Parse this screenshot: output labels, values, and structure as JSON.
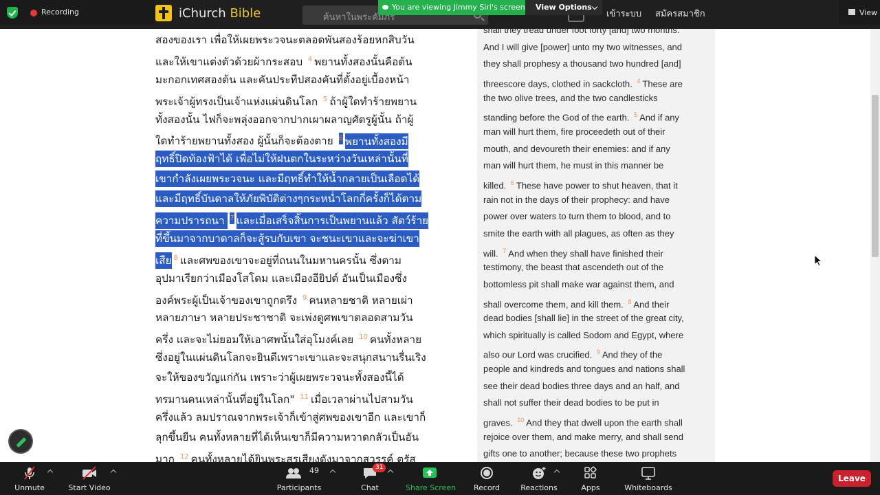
{
  "zoom": {
    "recording_label": "Recording",
    "viewing_banner": "You are viewing Jimmy Siri's screen",
    "view_options_label": "View Options",
    "view_right_label": "View",
    "toolbar": {
      "unmute": "Unmute",
      "start_video": "Start Video",
      "participants": "Participants",
      "participants_count": "49",
      "chat": "Chat",
      "chat_badge": "31",
      "share_screen": "Share Screen",
      "record": "Record",
      "reactions": "Reactions",
      "apps": "Apps",
      "whiteboards": "Whiteboards",
      "leave": "Leave"
    }
  },
  "site": {
    "logo_prefix": "iChurch",
    "logo_suffix": "Bible",
    "search_placeholder": "ค้นหาในพระคัมภีร์",
    "login": "เข้าระบบ",
    "register": "สมัครสมาชิก"
  },
  "thai_lines": [
    [
      {
        "t": "สองของเรา เพื่อให้เผยพระวจนะตลอดพันสองร้อยหกสิบวัน"
      }
    ],
    [
      {
        "t": "และให้เขาแต่งตัวด้วยผ้ากระสอบ "
      },
      {
        "v": "4"
      },
      {
        "t": "พยานทั้งสองนั้นคือต้น"
      }
    ],
    [
      {
        "t": "มะกอกเทศสองต้น และคันประทีปสองคันที่ตั้งอยู่เบื้องหน้า"
      }
    ],
    [
      {
        "t": "พระเจ้าผู้ทรงเป็นเจ้าแห่งแผ่นดินโลก "
      },
      {
        "v": "5"
      },
      {
        "t": "ถ้าผู้ใดทำร้ายพยาน"
      }
    ],
    [
      {
        "t": "ทั้งสองนั้น ไฟก็จะพลุ่งออกจากปากเผาผลาญศัตรูผู้นั้น ถ้าผู้"
      }
    ],
    [
      {
        "t": "ใดทำร้ายพยานทั้งสอง ผู้นั้นก็จะต้องตาย "
      },
      {
        "v": "6",
        "h": true
      },
      {
        "t": "พยานทั้งสองมี",
        "h": true
      }
    ],
    [
      {
        "t": "ฤทธิ์ปิดท้องฟ้าได้ เพื่อไม่ให้ฝนตกในระหว่างวันเหล่านั้นที่",
        "h": true
      }
    ],
    [
      {
        "t": "เขากำลังเผยพระวจนะ และมีฤทธิ์ทำให้น้ำกลายเป็นเลือดได้",
        "h": true
      }
    ],
    [
      {
        "t": "และมีฤทธิ์บันดาลให้ภัยพิบัติต่างๆกระหน่ำโลกกี่ครั้งก็ได้ตาม",
        "h": true
      }
    ],
    [
      {
        "t": "ความปรารถนา ",
        "h": true
      },
      {
        "v": "7",
        "h": true
      },
      {
        "t": "และเมื่อเสร็จสิ้นการเป็นพยานแล้ว สัตว์ร้าย",
        "h": true
      }
    ],
    [
      {
        "t": "ที่ขึ้นมาจากบาดาลก็จะสู้รบกับเขา จะชนะเขาและจะฆ่าเขา",
        "h": true
      }
    ],
    [
      {
        "t": "เสีย",
        "h": true
      },
      {
        "v": "8"
      },
      {
        "t": "และศพของเขาจะอยู่ที่ถนนในมหานครนั้น ซึ่งตาม"
      }
    ],
    [
      {
        "t": "อุปมาเรียกว่าเมืองโสโดม และเมืองอียิปต์ อันเป็นเมืองซึ่ง"
      }
    ],
    [
      {
        "t": "องค์พระผู้เป็นเจ้าของเขาถูกตรึง "
      },
      {
        "v": "9"
      },
      {
        "t": "คนหลายชาติ หลายเผ่า"
      }
    ],
    [
      {
        "t": "หลายภาษา หลายประชาชาติ จะเพ่งดูศพเขาตลอดสามวัน"
      }
    ],
    [
      {
        "t": "ครึ่ง และจะไม่ยอมให้เอาศพนั้นใส่อุโมงค์เลย "
      },
      {
        "v": "10"
      },
      {
        "t": "คนทั้งหลาย"
      }
    ],
    [
      {
        "t": "ซึ่งอยู่ในแผ่นดินโลกจะยินดีเพราะเขาและจะสนุกสนานรื่นเริง"
      }
    ],
    [
      {
        "t": "จะให้ของขวัญแก่กัน เพราะว่าผู้เผยพระวจนะทั้งสองนี้ได้"
      }
    ],
    [
      {
        "t": "ทรมานคนเหล่านั้นที่อยู่ในโลก\" "
      },
      {
        "v": "11"
      },
      {
        "t": "เมื่อเวลาผ่านไปสามวัน"
      }
    ],
    [
      {
        "t": "ครึ่งแล้ว ลมปราณจากพระเจ้าก็เข้าสู่ศพของเขาอีก และเขาก็"
      }
    ],
    [
      {
        "t": "ลุกขึ้นยืน คนทั้งหลายที่ได้เห็นเขาก็มีความหวาดกลัวเป็นอัน"
      }
    ],
    [
      {
        "t": "มาก "
      },
      {
        "v": "12"
      },
      {
        "t": "คนทั้งหลายได้ยินพระสุรเสียงดังมาจากสวรรค์ ตรัส"
      }
    ]
  ],
  "eng_lines": [
    [
      {
        "t": "shall they tread under foot forty [and] two months."
      }
    ],
    [
      {
        "t": "And I will give [power] unto my two witnesses, and"
      }
    ],
    [
      {
        "t": "they shall prophesy a thousand two hundred [and]"
      }
    ],
    [
      {
        "t": "threescore days, clothed in sackcloth. "
      },
      {
        "v": "4"
      },
      {
        "t": "These are"
      }
    ],
    [
      {
        "t": "the two olive trees, and the two candlesticks"
      }
    ],
    [
      {
        "t": "standing before the God of the earth. "
      },
      {
        "v": "5"
      },
      {
        "t": "And if any"
      }
    ],
    [
      {
        "t": "man will hurt them, fire proceedeth out of their"
      }
    ],
    [
      {
        "t": "mouth, and devoureth their enemies: and if any"
      }
    ],
    [
      {
        "t": "man will hurt them, he must in this manner be"
      }
    ],
    [
      {
        "t": "killed. "
      },
      {
        "v": "6"
      },
      {
        "t": "These have power to shut heaven, that it"
      }
    ],
    [
      {
        "t": "rain not in the days of their prophecy: and have"
      }
    ],
    [
      {
        "t": "power over waters to turn them to blood, and to"
      }
    ],
    [
      {
        "t": "smite the earth with all plagues, as often as they"
      }
    ],
    [
      {
        "t": "will. "
      },
      {
        "v": "7"
      },
      {
        "t": "And when they shall have finished their"
      }
    ],
    [
      {
        "t": "testimony, the beast that ascendeth out of the"
      }
    ],
    [
      {
        "t": "bottomless pit shall make war against them, and"
      }
    ],
    [
      {
        "t": "shall overcome them, and kill them. "
      },
      {
        "v": "8"
      },
      {
        "t": "And their"
      }
    ],
    [
      {
        "t": "dead bodies [shall lie] in the street of the great city,"
      }
    ],
    [
      {
        "t": "which spiritually is called Sodom and Egypt, where"
      }
    ],
    [
      {
        "t": "also our Lord was crucified. "
      },
      {
        "v": "9"
      },
      {
        "t": "And they of the"
      }
    ],
    [
      {
        "t": "people and kindreds and tongues and nations shall"
      }
    ],
    [
      {
        "t": "see their dead bodies three days and an half, and"
      }
    ],
    [
      {
        "t": "shall not suffer their dead bodies to be put in"
      }
    ],
    [
      {
        "t": "graves. "
      },
      {
        "v": "10"
      },
      {
        "t": "And they that dwell upon the earth shall"
      }
    ],
    [
      {
        "t": "rejoice over them, and make merry, and shall send"
      }
    ],
    [
      {
        "t": "gifts one to another; because these two prophets"
      }
    ]
  ],
  "colors": {
    "highlight": "#2a5cc4",
    "verse_number": "#e8955c",
    "zoom_green": "#23b04d",
    "leave_red": "#c8222f"
  }
}
